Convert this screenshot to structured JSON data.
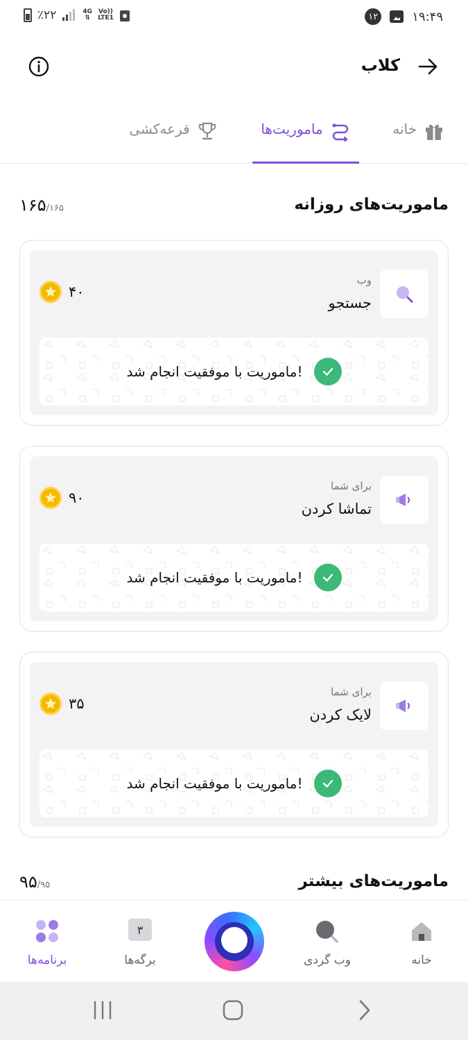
{
  "status_bar": {
    "battery": "٪۲۲",
    "network": "4G",
    "volte": "Vo))",
    "lte": "LTE1",
    "notif_count": "۱۲",
    "time": "۱۹:۴۹"
  },
  "header": {
    "title": "کلاب"
  },
  "tabs": [
    {
      "label": "خانه",
      "icon": "gift-icon",
      "active": false
    },
    {
      "label": "ماموریت‌ها",
      "icon": "route-icon",
      "active": true
    },
    {
      "label": "قرعه‌کشی",
      "icon": "trophy-icon",
      "active": false
    }
  ],
  "daily": {
    "title": "ماموریت‌های روزانه",
    "count": "۱۶۵",
    "total": "/۱۶۵"
  },
  "missions": [
    {
      "category": "وب",
      "title": "جستجو",
      "points": "۴۰",
      "status": "ماموریت با موفقیت انجام شد!",
      "icon": "search-icon"
    },
    {
      "category": "برای شما",
      "title": "تماشا کردن",
      "points": "۹۰",
      "status": "ماموریت با موفقیت انجام شد!",
      "icon": "megaphone-icon"
    },
    {
      "category": "برای شما",
      "title": "لایک کردن",
      "points": "۳۵",
      "status": "ماموریت با موفقیت انجام شد!",
      "icon": "megaphone-icon"
    }
  ],
  "more": {
    "title": "ماموریت‌های بیشتر",
    "count": "۹۵",
    "total": "/۹۵"
  },
  "bottom_nav": {
    "home": "خانه",
    "web": "وب گردی",
    "tabs": "برگه‌ها",
    "tabs_count": "۳",
    "apps": "برنامه‌ها"
  },
  "colors": {
    "accent": "#7a4fd6",
    "success": "#3cb878",
    "coin": "#f5b800"
  }
}
